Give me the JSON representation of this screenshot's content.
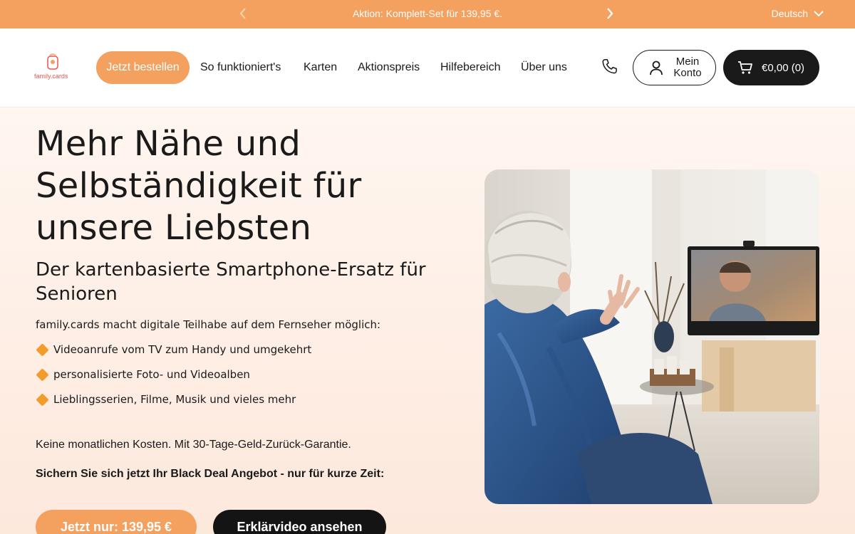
{
  "announcement": {
    "promo_text": "Aktion: Komplett-Set für 139,95 €.",
    "language": "Deutsch",
    "prev_icon": "chevron-left-icon",
    "next_icon": "chevron-right-icon"
  },
  "header": {
    "logo_text": "family.cards",
    "order_button": "Jetzt bestellen",
    "nav": [
      "So funktioniert's",
      "Karten",
      "Aktionspreis",
      "Hilfebereich",
      "Über uns"
    ],
    "account_label": "Mein Konto",
    "cart_label": "€0,00 (0)",
    "icons": {
      "phone": "phone-icon",
      "account": "user-icon",
      "cart": "cart-icon"
    }
  },
  "hero": {
    "headline": "Mehr Nähe und Selbständigkeit für unsere Liebsten",
    "subheadline": "Der kartenbasierte Smartphone-Ersatz für Senioren",
    "intro": "family.cards macht digitale Teilhabe auf dem Fernseher möglich:",
    "bullets": [
      "Videoanrufe vom TV zum Handy und umgekehrt",
      "personalisierte Foto- und Videoalben",
      "Lieblingsserien, Filme, Musik und vieles mehr"
    ],
    "note_costs": "Keine monatlichen Kosten. Mit 30-Tage-Geld-Zurück-Garantie.",
    "note_deal": "Sichern Sie sich jetzt Ihr Black Deal Angebot - nur für kurze Zeit:",
    "price_button": "Jetzt nur: 139,95 €",
    "video_button": "Erklärvideo ansehen"
  },
  "colors": {
    "accent": "#f4a05f",
    "dark": "#1a1a1a",
    "bullet": "#f39c2c"
  }
}
